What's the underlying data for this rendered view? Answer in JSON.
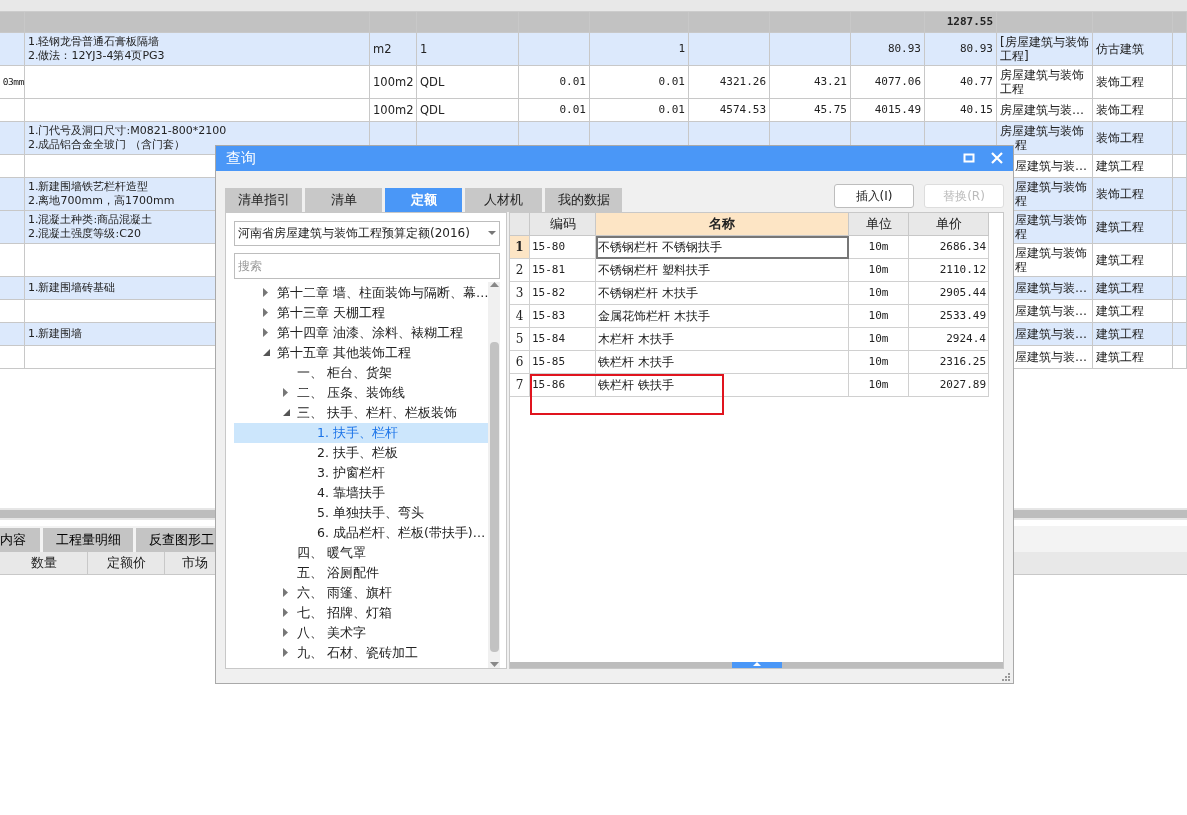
{
  "table": {
    "rows": [
      {
        "kind": "summary",
        "column_10": "1287.55"
      },
      {
        "kind": "bill",
        "column_2": [
          "1.轻钢龙骨普通石膏板隔墙",
          "2.做法：12YJ3-4第4页PG3"
        ],
        "column_3": "m2",
        "column_4": "1",
        "column_6": "1",
        "column_9": "80.93",
        "column_10": "80.93",
        "column_11": "[房屋建筑与装饰工程]",
        "column_12": "仿古建筑"
      },
      {
        "kind": "item",
        "column_1": "03mm",
        "column_3": "100m2",
        "column_4": "QDL",
        "column_5": "0.01",
        "column_6": "0.01",
        "column_7": "4321.26",
        "column_8": "43.21",
        "column_9": "4077.06",
        "column_10": "40.77",
        "column_11": "房屋建筑与装饰工程",
        "column_12": "装饰工程"
      },
      {
        "kind": "item",
        "column_3": "100m2",
        "column_4": "QDL",
        "column_5": "0.01",
        "column_6": "0.01",
        "column_7": "4574.53",
        "column_8": "45.75",
        "column_9": "4015.49",
        "column_10": "40.15",
        "column_11": "房屋建筑与装…",
        "column_12": "装饰工程"
      },
      {
        "kind": "bill",
        "column_2": [
          "1.门代号及洞口尺寸:M0821-800*2100",
          "2.成品铝合金全玻门 （含门套）"
        ],
        "column_11": "房屋建筑与装饰程",
        "column_12": "装饰工程"
      },
      {
        "kind": "item",
        "column_11": "屋建筑与装…",
        "column_12": "建筑工程"
      },
      {
        "kind": "bill",
        "column_2": [
          "1.新建围墙铁艺栏杆造型",
          "2.离地700mm，高1700mm"
        ],
        "column_11": "屋建筑与装饰程",
        "column_12": "装饰工程"
      },
      {
        "kind": "bill",
        "column_2": [
          "1.混凝土种类:商品混凝土",
          "2.混凝土强度等级:C20"
        ],
        "column_11": "屋建筑与装饰程",
        "column_12": "建筑工程"
      },
      {
        "kind": "item",
        "column_11": "屋建筑与装饰程",
        "column_12": "建筑工程"
      },
      {
        "kind": "bill",
        "column_2": [
          "1.新建围墙砖基础"
        ],
        "column_11": "屋建筑与装…",
        "column_12": "建筑工程"
      },
      {
        "kind": "item",
        "column_11": "屋建筑与装…",
        "column_12": "建筑工程"
      },
      {
        "kind": "bill",
        "column_2": [
          "1.新建围墙"
        ],
        "column_11": "屋建筑与装…",
        "column_12": "建筑工程"
      },
      {
        "kind": "item",
        "column_11": "屋建筑与装…",
        "column_12": "建筑工程"
      }
    ]
  },
  "bottom_panel": {
    "tabs": [
      {
        "label": "内容",
        "selected": false
      },
      {
        "label": "工程量明细",
        "selected": false
      },
      {
        "label": "反查图形工",
        "selected": false
      }
    ],
    "columns": [
      "数量",
      "定额价",
      "市场"
    ]
  },
  "dialog": {
    "title": "查询",
    "tabs": [
      {
        "label": "清单指引",
        "selected": false
      },
      {
        "label": "清单",
        "selected": false
      },
      {
        "label": "定额",
        "selected": true
      },
      {
        "label": "人材机",
        "selected": false
      },
      {
        "label": "我的数据",
        "selected": false
      }
    ],
    "buttons": [
      {
        "label": "插入(I)",
        "disabled": false
      },
      {
        "label": "替换(R)",
        "disabled": true
      }
    ],
    "library": {
      "value": "河南省房屋建筑与装饰工程预算定额(2016)"
    },
    "search": {
      "placeholder": "搜索"
    },
    "tree": [
      {
        "label": "第十二章 墙、柱面装饰与隔断、幕…",
        "expanded": false,
        "selected": false
      },
      {
        "label": "第十三章 天棚工程",
        "expanded": false,
        "selected": false
      },
      {
        "label": "第十四章 油漆、涂料、裱糊工程",
        "expanded": false,
        "selected": false
      },
      {
        "label": "第十五章 其他装饰工程",
        "expanded": true,
        "selected": false,
        "children": [
          {
            "label": "一、 柜台、货架",
            "selected": false
          },
          {
            "label": "二、 压条、装饰线",
            "expanded": false,
            "selected": false
          },
          {
            "label": "三、 扶手、栏杆、栏板装饰",
            "expanded": true,
            "selected": false,
            "children": [
              {
                "label": "1. 扶手、栏杆",
                "selected": true
              },
              {
                "label": "2. 扶手、栏板",
                "selected": false
              },
              {
                "label": "3. 护窗栏杆",
                "selected": false
              },
              {
                "label": "4. 靠墙扶手",
                "selected": false
              },
              {
                "label": "5. 单独扶手、弯头",
                "selected": false
              },
              {
                "label": "6. 成品栏杆、栏板(带扶手)…",
                "selected": false
              }
            ]
          },
          {
            "label": "四、 暖气罩",
            "selected": false
          },
          {
            "label": "五、 浴厕配件",
            "selected": false
          },
          {
            "label": "六、 雨篷、旗杆",
            "expanded": false,
            "selected": false
          },
          {
            "label": "七、 招牌、灯箱",
            "expanded": false,
            "selected": false
          },
          {
            "label": "八、 美术字",
            "expanded": false,
            "selected": false
          },
          {
            "label": "九、 石材、瓷砖加工",
            "expanded": false,
            "selected": false
          }
        ]
      }
    ],
    "grid": {
      "columns": [
        {
          "label": "编码",
          "selected": false
        },
        {
          "label": "名称",
          "selected": true
        },
        {
          "label": "单位",
          "selected": false
        },
        {
          "label": "单价",
          "selected": false
        }
      ],
      "rows": [
        {
          "number": "1",
          "code": "15-80",
          "name": "不锈钢栏杆 不锈钢扶手",
          "unit": "10m",
          "price": "2686.34",
          "selected": true
        },
        {
          "number": "2",
          "code": "15-81",
          "name": "不锈钢栏杆 塑料扶手",
          "unit": "10m",
          "price": "2110.12",
          "selected": false
        },
        {
          "number": "3",
          "code": "15-82",
          "name": "不锈钢栏杆 木扶手",
          "unit": "10m",
          "price": "2905.44",
          "selected": false
        },
        {
          "number": "4",
          "code": "15-83",
          "name": "金属花饰栏杆 木扶手",
          "unit": "10m",
          "price": "2533.49",
          "selected": false
        },
        {
          "number": "5",
          "code": "15-84",
          "name": "木栏杆 木扶手",
          "unit": "10m",
          "price": "2924.4",
          "selected": false
        },
        {
          "number": "6",
          "code": "15-85",
          "name": "铁栏杆 木扶手",
          "unit": "10m",
          "price": "2316.25",
          "selected": false
        },
        {
          "number": "7",
          "code": "15-86",
          "name": "铁栏杆 铁扶手",
          "unit": "10m",
          "price": "2027.89",
          "selected": false
        }
      ]
    }
  }
}
